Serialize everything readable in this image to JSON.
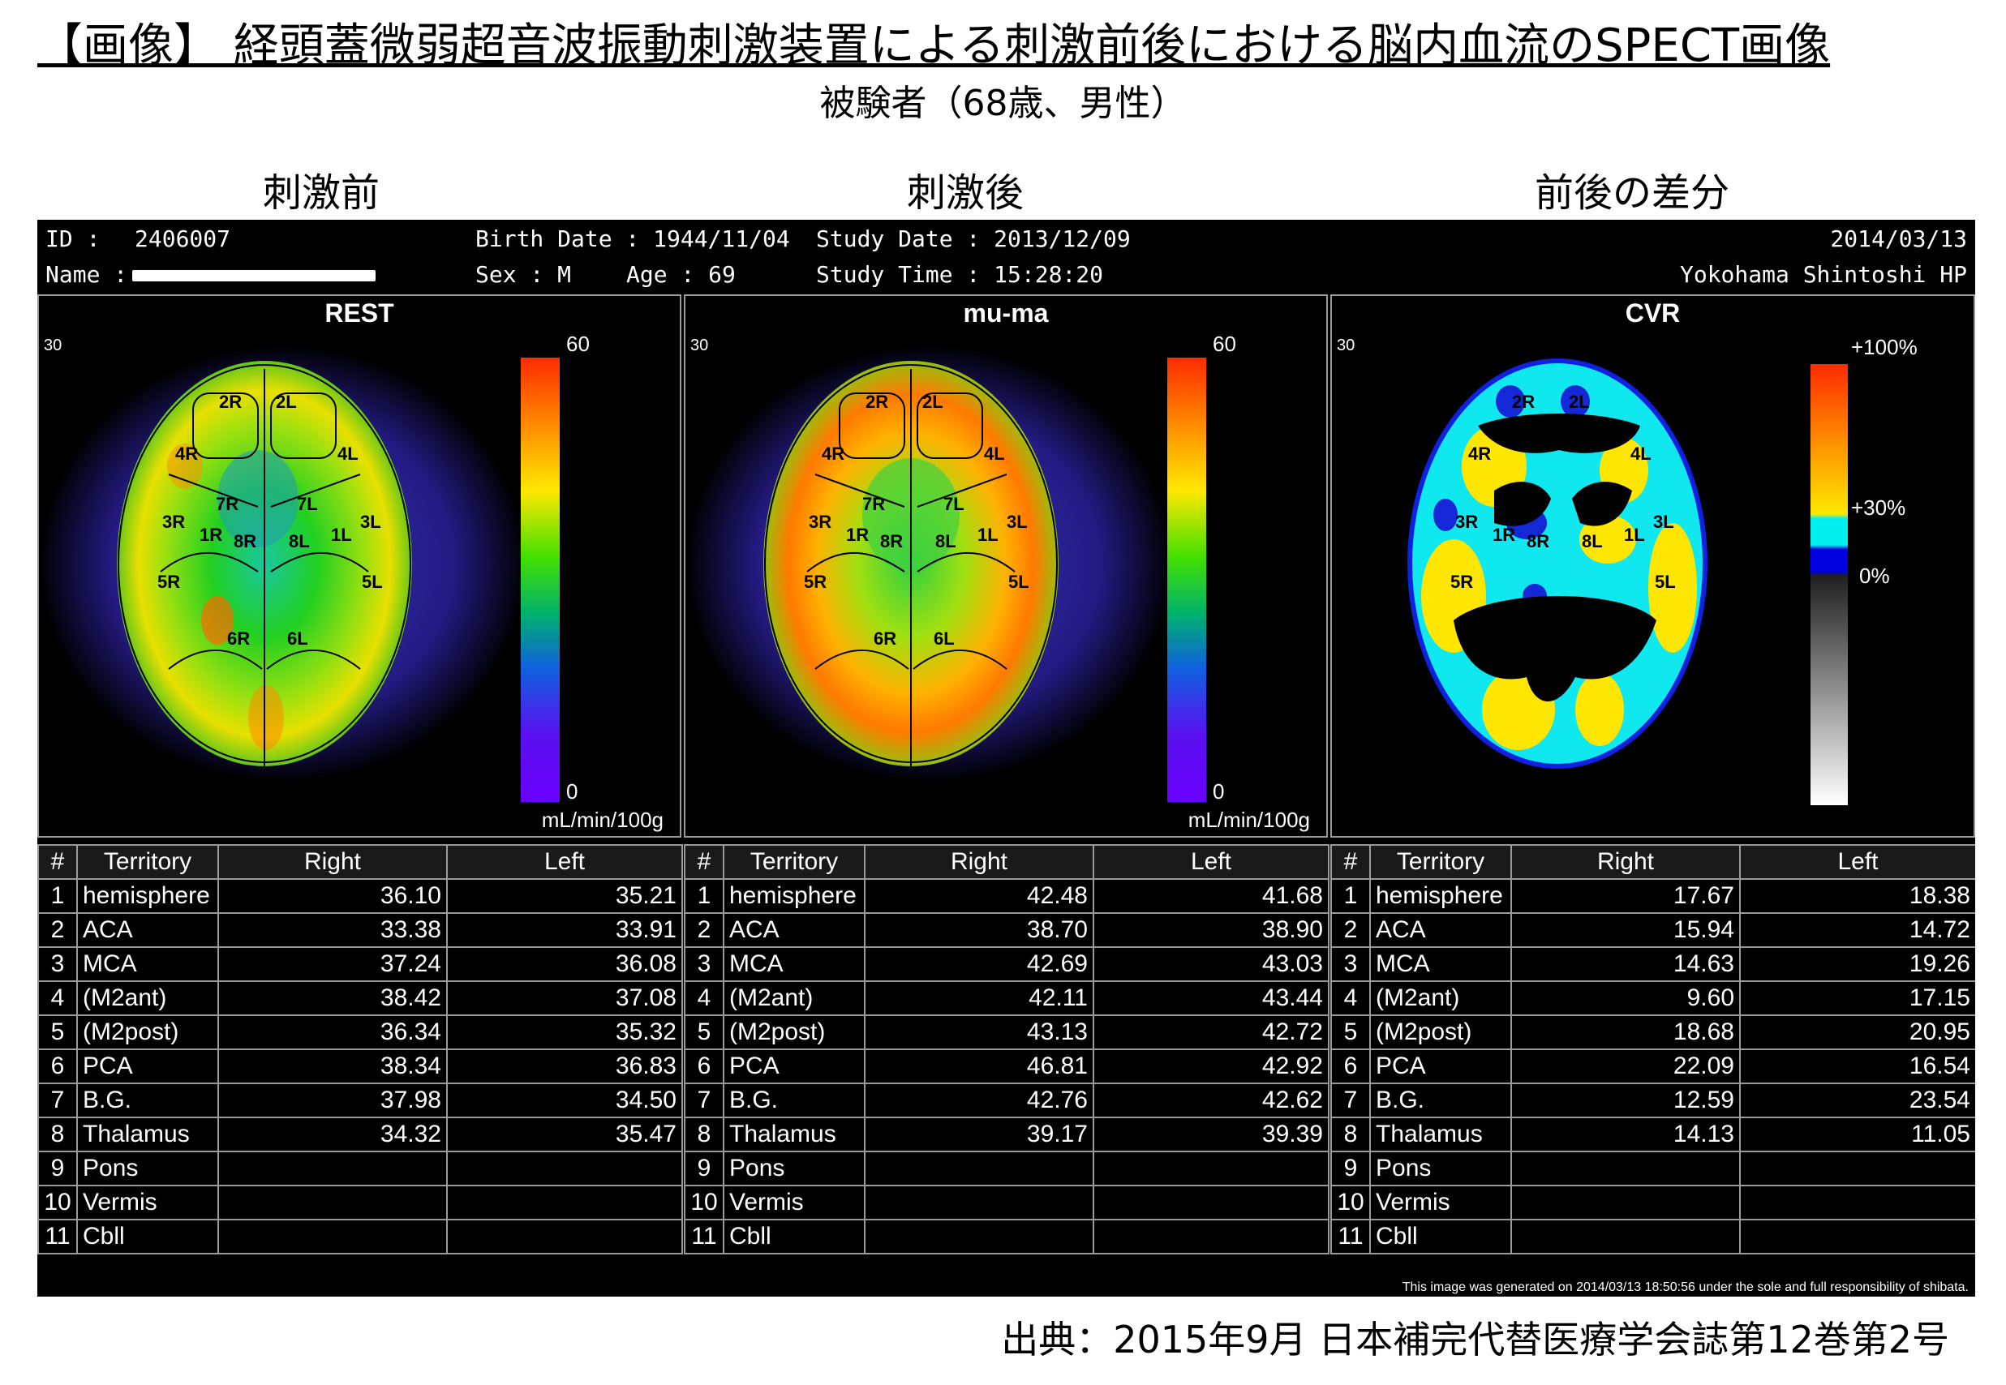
{
  "header": {
    "title": "【画像】 経頭蓋微弱超音波振動刺激装置による刺激前後における脳内血流のSPECT画像",
    "subtitle": "被験者（68歳、男性）"
  },
  "panel_labels": [
    "刺激前",
    "刺激後",
    "前後の差分"
  ],
  "patient": {
    "id_label": "ID :",
    "id_value": "2406007",
    "name_label": "Name :",
    "birth_date": "Birth Date : 1944/11/04",
    "sex": "Sex : M",
    "age": "Age : 69",
    "study_date": "Study Date : 2013/12/09",
    "study_time": "Study Time : 15:28:20",
    "report_date": "2014/03/13",
    "hospital": "Yokohama Shintoshi HP"
  },
  "panes": [
    {
      "title": "REST",
      "corner": "30",
      "scale_top": "60",
      "scale_bottom": "0",
      "unit": "mL/min/100g"
    },
    {
      "title": "mu-ma",
      "corner": "30",
      "scale_top": "60",
      "scale_bottom": "0",
      "unit": "mL/min/100g"
    },
    {
      "title": "CVR",
      "corner": "30",
      "scale_top": "+100%",
      "scale_mid": "+30%",
      "scale_zero": "0%"
    }
  ],
  "region_labels": [
    "2R",
    "2L",
    "4R",
    "4L",
    "7R",
    "7L",
    "3R",
    "3L",
    "1R",
    "1L",
    "8R",
    "8L",
    "5R",
    "5L",
    "6R",
    "6L"
  ],
  "table_headers": [
    "#",
    "Territory",
    "Right",
    "Left"
  ],
  "tables": [
    {
      "rows": [
        {
          "n": "1",
          "territory": "hemisphere",
          "right": "36.10",
          "left": "35.21"
        },
        {
          "n": "2",
          "territory": "ACA",
          "right": "33.38",
          "left": "33.91"
        },
        {
          "n": "3",
          "territory": "MCA",
          "right": "37.24",
          "left": "36.08"
        },
        {
          "n": "4",
          "territory": "(M2ant)",
          "right": "38.42",
          "left": "37.08"
        },
        {
          "n": "5",
          "territory": "(M2post)",
          "right": "36.34",
          "left": "35.32"
        },
        {
          "n": "6",
          "territory": "PCA",
          "right": "38.34",
          "left": "36.83"
        },
        {
          "n": "7",
          "territory": "B.G.",
          "right": "37.98",
          "left": "34.50"
        },
        {
          "n": "8",
          "territory": "Thalamus",
          "right": "34.32",
          "left": "35.47"
        },
        {
          "n": "9",
          "territory": "Pons",
          "right": "",
          "left": ""
        },
        {
          "n": "10",
          "territory": "Vermis",
          "right": "",
          "left": ""
        },
        {
          "n": "11",
          "territory": "Cbll",
          "right": "",
          "left": ""
        }
      ]
    },
    {
      "rows": [
        {
          "n": "1",
          "territory": "hemisphere",
          "right": "42.48",
          "left": "41.68"
        },
        {
          "n": "2",
          "territory": "ACA",
          "right": "38.70",
          "left": "38.90"
        },
        {
          "n": "3",
          "territory": "MCA",
          "right": "42.69",
          "left": "43.03"
        },
        {
          "n": "4",
          "territory": "(M2ant)",
          "right": "42.11",
          "left": "43.44"
        },
        {
          "n": "5",
          "territory": "(M2post)",
          "right": "43.13",
          "left": "42.72"
        },
        {
          "n": "6",
          "territory": "PCA",
          "right": "46.81",
          "left": "42.92"
        },
        {
          "n": "7",
          "territory": "B.G.",
          "right": "42.76",
          "left": "42.62"
        },
        {
          "n": "8",
          "territory": "Thalamus",
          "right": "39.17",
          "left": "39.39"
        },
        {
          "n": "9",
          "territory": "Pons",
          "right": "",
          "left": ""
        },
        {
          "n": "10",
          "territory": "Vermis",
          "right": "",
          "left": ""
        },
        {
          "n": "11",
          "territory": "Cbll",
          "right": "",
          "left": ""
        }
      ]
    },
    {
      "rows": [
        {
          "n": "1",
          "territory": "hemisphere",
          "right": "17.67",
          "left": "18.38"
        },
        {
          "n": "2",
          "territory": "ACA",
          "right": "15.94",
          "left": "14.72"
        },
        {
          "n": "3",
          "territory": "MCA",
          "right": "14.63",
          "left": "19.26"
        },
        {
          "n": "4",
          "territory": "(M2ant)",
          "right": "9.60",
          "left": "17.15"
        },
        {
          "n": "5",
          "territory": "(M2post)",
          "right": "18.68",
          "left": "20.95"
        },
        {
          "n": "6",
          "territory": "PCA",
          "right": "22.09",
          "left": "16.54"
        },
        {
          "n": "7",
          "territory": "B.G.",
          "right": "12.59",
          "left": "23.54"
        },
        {
          "n": "8",
          "territory": "Thalamus",
          "right": "14.13",
          "left": "11.05"
        },
        {
          "n": "9",
          "territory": "Pons",
          "right": "",
          "left": ""
        },
        {
          "n": "10",
          "territory": "Vermis",
          "right": "",
          "left": ""
        },
        {
          "n": "11",
          "territory": "Cbll",
          "right": "",
          "left": ""
        }
      ]
    }
  ],
  "footer_note": "This image was generated on 2014/03/13 18:50:56 under the sole and full responsibility of shibata.",
  "source": "出典：2015年9月 日本補完代替医療学会誌第12巻第2号"
}
